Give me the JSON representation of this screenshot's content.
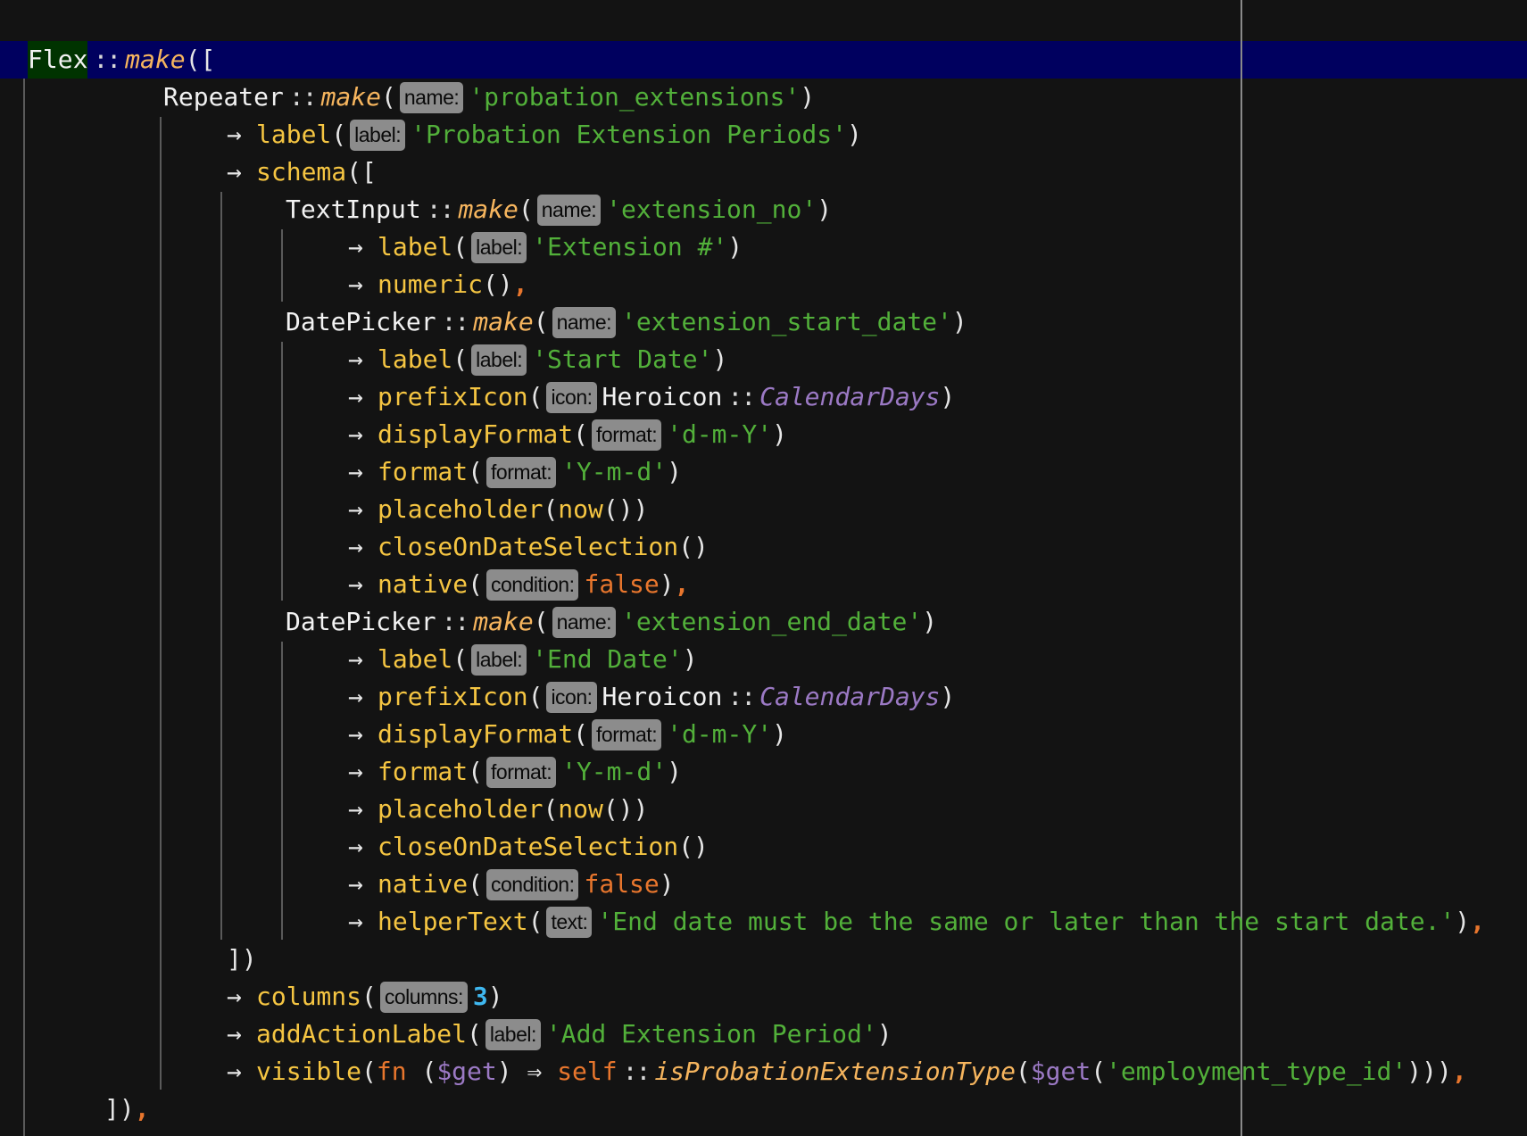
{
  "editor": {
    "colors": {
      "background": "#131313",
      "current_line": "#00005f",
      "string": "#52b03a",
      "method": "#f5c542",
      "keyword": "#e8762d",
      "variable": "#9b79c4",
      "number": "#3fb8f0"
    },
    "lines": [
      {
        "indent": 0,
        "tokens": [
          [
            "flex",
            "Flex"
          ],
          [
            "op",
            "::"
          ],
          [
            "fn",
            "make"
          ],
          [
            "p",
            "(["
          ]
        ]
      },
      {
        "indent": 1,
        "tokens": [
          [
            "cls",
            "Repeater"
          ],
          [
            "op",
            "::"
          ],
          [
            "fn",
            "make"
          ],
          [
            "p",
            "("
          ],
          [
            "badge",
            "name:"
          ],
          [
            "str",
            "'probation_extensions'"
          ],
          [
            "p",
            ")"
          ]
        ]
      },
      {
        "indent": 2,
        "tokens": [
          [
            "arrow",
            "→"
          ],
          [
            "method",
            "label"
          ],
          [
            "p",
            "("
          ],
          [
            "badge",
            "label:"
          ],
          [
            "str",
            "'Probation Extension Periods'"
          ],
          [
            "p",
            ")"
          ]
        ]
      },
      {
        "indent": 2,
        "tokens": [
          [
            "arrow",
            "→"
          ],
          [
            "method",
            "schema"
          ],
          [
            "p",
            "(["
          ]
        ]
      },
      {
        "indent": 3,
        "tokens": [
          [
            "cls",
            "TextInput"
          ],
          [
            "op",
            "::"
          ],
          [
            "fn",
            "make"
          ],
          [
            "p",
            "("
          ],
          [
            "badge",
            "name:"
          ],
          [
            "str",
            "'extension_no'"
          ],
          [
            "p",
            ")"
          ]
        ]
      },
      {
        "indent": 4,
        "tokens": [
          [
            "arrow",
            "→"
          ],
          [
            "method",
            "label"
          ],
          [
            "p",
            "("
          ],
          [
            "badge",
            "label:"
          ],
          [
            "str",
            "'Extension #'"
          ],
          [
            "p",
            ")"
          ]
        ]
      },
      {
        "indent": 4,
        "tokens": [
          [
            "arrow",
            "→"
          ],
          [
            "method",
            "numeric"
          ],
          [
            "p",
            "()"
          ],
          [
            "comma",
            ","
          ]
        ]
      },
      {
        "indent": 3,
        "tokens": [
          [
            "cls",
            "DatePicker"
          ],
          [
            "op",
            "::"
          ],
          [
            "fn",
            "make"
          ],
          [
            "p",
            "("
          ],
          [
            "badge",
            "name:"
          ],
          [
            "str",
            "'extension_start_date'"
          ],
          [
            "p",
            ")"
          ]
        ]
      },
      {
        "indent": 4,
        "tokens": [
          [
            "arrow",
            "→"
          ],
          [
            "method",
            "label"
          ],
          [
            "p",
            "("
          ],
          [
            "badge",
            "label:"
          ],
          [
            "str",
            "'Start Date'"
          ],
          [
            "p",
            ")"
          ]
        ]
      },
      {
        "indent": 4,
        "tokens": [
          [
            "arrow",
            "→"
          ],
          [
            "method",
            "prefixIcon"
          ],
          [
            "p",
            "("
          ],
          [
            "badge",
            "icon:"
          ],
          [
            "cls",
            "Heroicon"
          ],
          [
            "op",
            "::"
          ],
          [
            "const",
            "CalendarDays"
          ],
          [
            "p",
            ")"
          ]
        ]
      },
      {
        "indent": 4,
        "tokens": [
          [
            "arrow",
            "→"
          ],
          [
            "method",
            "displayFormat"
          ],
          [
            "p",
            "("
          ],
          [
            "badge",
            "format:"
          ],
          [
            "str",
            "'d-m-Y'"
          ],
          [
            "p",
            ")"
          ]
        ]
      },
      {
        "indent": 4,
        "tokens": [
          [
            "arrow",
            "→"
          ],
          [
            "method",
            "format"
          ],
          [
            "p",
            "("
          ],
          [
            "badge",
            "format:"
          ],
          [
            "str",
            "'Y-m-d'"
          ],
          [
            "p",
            ")"
          ]
        ]
      },
      {
        "indent": 4,
        "tokens": [
          [
            "arrow",
            "→"
          ],
          [
            "method",
            "placeholder"
          ],
          [
            "p",
            "("
          ],
          [
            "method",
            "now"
          ],
          [
            "p",
            "())"
          ]
        ]
      },
      {
        "indent": 4,
        "tokens": [
          [
            "arrow",
            "→"
          ],
          [
            "method",
            "closeOnDateSelection"
          ],
          [
            "p",
            "()"
          ]
        ]
      },
      {
        "indent": 4,
        "tokens": [
          [
            "arrow",
            "→"
          ],
          [
            "method",
            "native"
          ],
          [
            "p",
            "("
          ],
          [
            "badge",
            "condition:"
          ],
          [
            "kw",
            "false"
          ],
          [
            "p",
            ")"
          ],
          [
            "comma",
            ","
          ]
        ]
      },
      {
        "indent": 3,
        "tokens": [
          [
            "cls",
            "DatePicker"
          ],
          [
            "op",
            "::"
          ],
          [
            "fn",
            "make"
          ],
          [
            "p",
            "("
          ],
          [
            "badge",
            "name:"
          ],
          [
            "str",
            "'extension_end_date'"
          ],
          [
            "p",
            ")"
          ]
        ]
      },
      {
        "indent": 4,
        "tokens": [
          [
            "arrow",
            "→"
          ],
          [
            "method",
            "label"
          ],
          [
            "p",
            "("
          ],
          [
            "badge",
            "label:"
          ],
          [
            "str",
            "'End Date'"
          ],
          [
            "p",
            ")"
          ]
        ]
      },
      {
        "indent": 4,
        "tokens": [
          [
            "arrow",
            "→"
          ],
          [
            "method",
            "prefixIcon"
          ],
          [
            "p",
            "("
          ],
          [
            "badge",
            "icon:"
          ],
          [
            "cls",
            "Heroicon"
          ],
          [
            "op",
            "::"
          ],
          [
            "const",
            "CalendarDays"
          ],
          [
            "p",
            ")"
          ]
        ]
      },
      {
        "indent": 4,
        "tokens": [
          [
            "arrow",
            "→"
          ],
          [
            "method",
            "displayFormat"
          ],
          [
            "p",
            "("
          ],
          [
            "badge",
            "format:"
          ],
          [
            "str",
            "'d-m-Y'"
          ],
          [
            "p",
            ")"
          ]
        ]
      },
      {
        "indent": 4,
        "tokens": [
          [
            "arrow",
            "→"
          ],
          [
            "method",
            "format"
          ],
          [
            "p",
            "("
          ],
          [
            "badge",
            "format:"
          ],
          [
            "str",
            "'Y-m-d'"
          ],
          [
            "p",
            ")"
          ]
        ]
      },
      {
        "indent": 4,
        "tokens": [
          [
            "arrow",
            "→"
          ],
          [
            "method",
            "placeholder"
          ],
          [
            "p",
            "("
          ],
          [
            "method",
            "now"
          ],
          [
            "p",
            "())"
          ]
        ]
      },
      {
        "indent": 4,
        "tokens": [
          [
            "arrow",
            "→"
          ],
          [
            "method",
            "closeOnDateSelection"
          ],
          [
            "p",
            "()"
          ]
        ]
      },
      {
        "indent": 4,
        "tokens": [
          [
            "arrow",
            "→"
          ],
          [
            "method",
            "native"
          ],
          [
            "p",
            "("
          ],
          [
            "badge",
            "condition:"
          ],
          [
            "kw",
            "false"
          ],
          [
            "p",
            ")"
          ]
        ]
      },
      {
        "indent": 4,
        "tokens": [
          [
            "arrow",
            "→"
          ],
          [
            "method",
            "helperText"
          ],
          [
            "p",
            "("
          ],
          [
            "badge",
            "text:"
          ],
          [
            "str",
            "'End date must be the same or later than the start date.'"
          ],
          [
            "p",
            ")"
          ],
          [
            "comma",
            ","
          ]
        ]
      },
      {
        "indent": 2,
        "tokens": [
          [
            "p",
            "])"
          ]
        ]
      },
      {
        "indent": 2,
        "tokens": [
          [
            "arrow",
            "→"
          ],
          [
            "method",
            "columns"
          ],
          [
            "p",
            "("
          ],
          [
            "badge",
            "columns:"
          ],
          [
            "num",
            "3"
          ],
          [
            "p",
            ")"
          ]
        ]
      },
      {
        "indent": 2,
        "tokens": [
          [
            "arrow",
            "→"
          ],
          [
            "method",
            "addActionLabel"
          ],
          [
            "p",
            "("
          ],
          [
            "badge",
            "label:"
          ],
          [
            "str",
            "'Add Extension Period'"
          ],
          [
            "p",
            ")"
          ]
        ]
      },
      {
        "indent": 2,
        "tokens": [
          [
            "arrow",
            "→"
          ],
          [
            "method",
            "visible"
          ],
          [
            "p",
            "("
          ],
          [
            "kw",
            "fn "
          ],
          [
            "p",
            "("
          ],
          [
            "var",
            "$get"
          ],
          [
            "p",
            ") ⇒ "
          ],
          [
            "kw",
            "self"
          ],
          [
            "op",
            "::"
          ],
          [
            "smethod",
            "isProbationExtensionType"
          ],
          [
            "p",
            "("
          ],
          [
            "var",
            "$get"
          ],
          [
            "p",
            "("
          ],
          [
            "str",
            "'employment_type_id'"
          ],
          [
            "p",
            ")))"
          ],
          [
            "comma",
            ","
          ]
        ]
      },
      {
        "indent": -1,
        "tokens": [
          [
            "p",
            "])"
          ],
          [
            "comma",
            ","
          ]
        ]
      }
    ]
  }
}
